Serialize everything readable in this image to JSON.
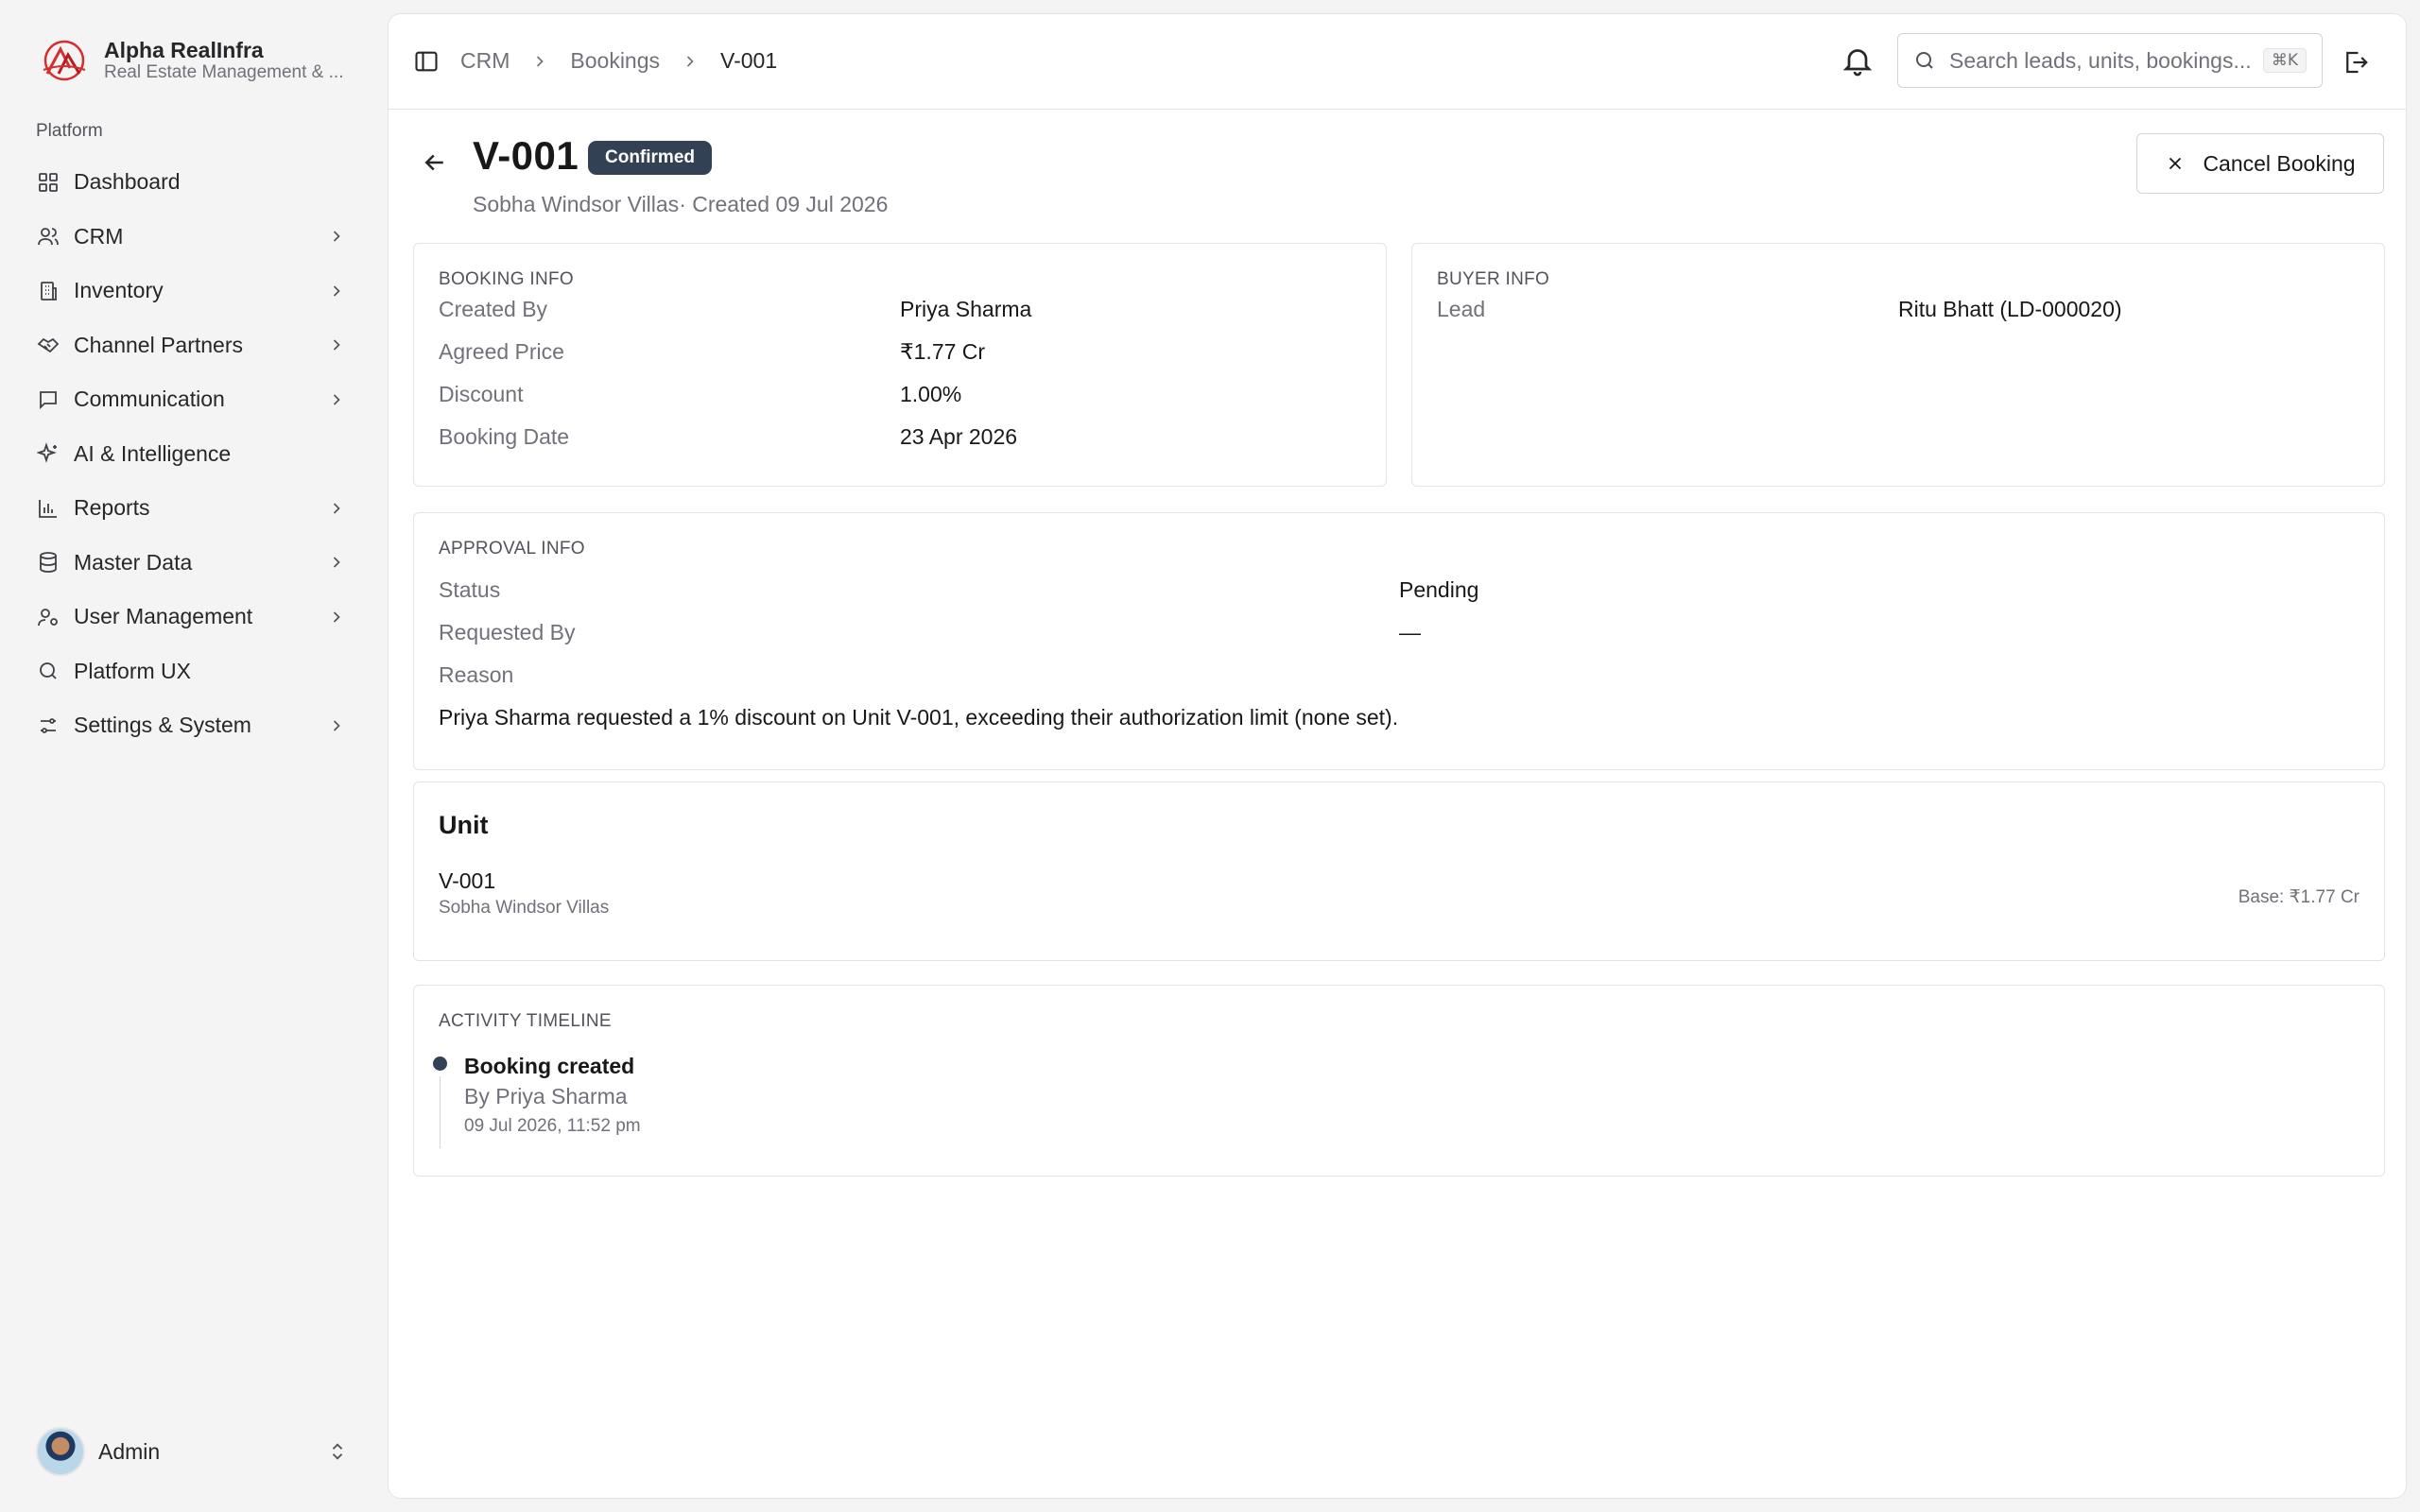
{
  "brand": {
    "name": "Alpha RealInfra",
    "tagline": "Real Estate Management & ..."
  },
  "sidebar": {
    "section_label": "Platform",
    "items": [
      {
        "label": "Dashboard",
        "icon": "dashboard-icon",
        "has_children": false
      },
      {
        "label": "CRM",
        "icon": "users-icon",
        "has_children": true
      },
      {
        "label": "Inventory",
        "icon": "building-icon",
        "has_children": true
      },
      {
        "label": "Channel Partners",
        "icon": "handshake-icon",
        "has_children": true
      },
      {
        "label": "Communication",
        "icon": "message-icon",
        "has_children": true
      },
      {
        "label": "AI & Intelligence",
        "icon": "sparkles-icon",
        "has_children": false
      },
      {
        "label": "Reports",
        "icon": "bar-chart-icon",
        "has_children": true
      },
      {
        "label": "Master Data",
        "icon": "database-icon",
        "has_children": true
      },
      {
        "label": "User Management",
        "icon": "user-cog-icon",
        "has_children": true
      },
      {
        "label": "Platform UX",
        "icon": "search-icon",
        "has_children": false
      },
      {
        "label": "Settings & System",
        "icon": "sliders-icon",
        "has_children": true
      }
    ],
    "user": {
      "name": "Admin"
    }
  },
  "topbar": {
    "breadcrumbs": [
      "CRM",
      "Bookings",
      "V-001"
    ],
    "search_placeholder": "Search leads, units, bookings...",
    "search_shortcut": "⌘K"
  },
  "header": {
    "title": "V-001",
    "status": "Confirmed",
    "project": "Sobha Windsor Villas",
    "created": "· Created 09 Jul 2026",
    "cancel_label": "Cancel Booking"
  },
  "booking_info": {
    "label": "BOOKING INFO",
    "rows": [
      {
        "key": "Created By",
        "value": "Priya Sharma"
      },
      {
        "key": "Agreed Price",
        "value": "₹1.77 Cr"
      },
      {
        "key": "Discount",
        "value": "1.00%"
      },
      {
        "key": "Booking Date",
        "value": "23 Apr 2026"
      }
    ]
  },
  "buyer_info": {
    "label": "BUYER INFO",
    "rows": [
      {
        "key": "Lead",
        "value": "Ritu Bhatt (LD-000020)"
      }
    ]
  },
  "approval_info": {
    "label": "APPROVAL INFO",
    "rows": [
      {
        "key": "Status",
        "value": "Pending"
      },
      {
        "key": "Requested By",
        "value": "—"
      }
    ],
    "reason_label": "Reason",
    "reason_text": "Priya Sharma requested a 1% discount on Unit V-001, exceeding their authorization limit (none set)."
  },
  "unit": {
    "heading": "Unit",
    "code": "V-001",
    "project": "Sobha Windsor Villas",
    "base": "Base: ₹1.77 Cr"
  },
  "timeline": {
    "label": "ACTIVITY TIMELINE",
    "events": [
      {
        "title": "Booking created",
        "by": "By Priya Sharma",
        "time": "09 Jul 2026, 11:52 pm"
      }
    ]
  },
  "colors": {
    "badge": "#334155",
    "text": "#18181b",
    "muted": "#71717a",
    "border": "#e4e4e7",
    "brand": "#d32f2f"
  }
}
